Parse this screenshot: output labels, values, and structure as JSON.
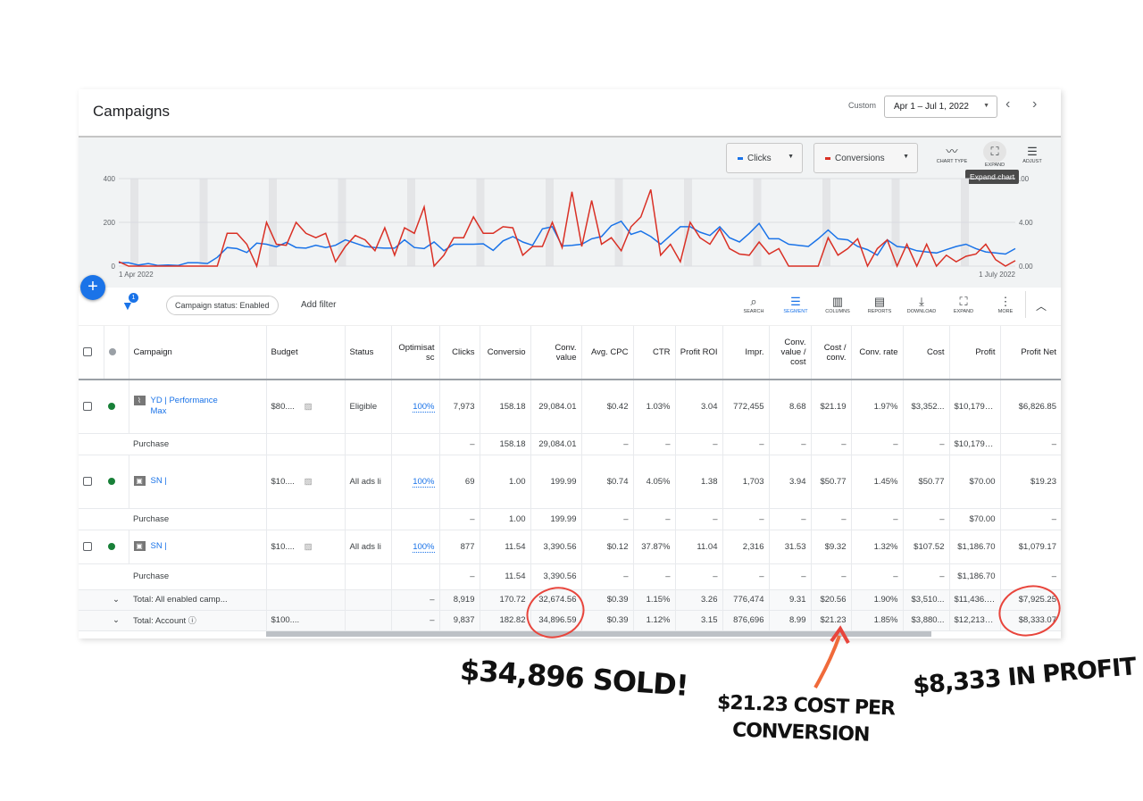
{
  "header": {
    "title": "Campaigns",
    "custom_label": "Custom",
    "date_range": "Apr 1 – Jul 1, 2022",
    "prev_icon": "chevron-left-icon",
    "next_icon": "chevron-right-icon"
  },
  "chart_controls": {
    "metric1": "Clicks",
    "metric2": "Conversions",
    "tools": [
      {
        "label": "CHART TYPE",
        "icon": "line-chart-icon"
      },
      {
        "label": "EXPAND",
        "icon": "expand-icon"
      },
      {
        "label": "ADJUST",
        "icon": "sliders-icon"
      }
    ],
    "tooltip": "Expand chart"
  },
  "chart_data": {
    "type": "line",
    "x_start": "1 Apr 2022",
    "x_end": "1 July 2022",
    "x_labels": [
      "1 Apr 2022",
      "1 July 2022"
    ],
    "y_left": {
      "ticks": [
        "0",
        "200",
        "400"
      ],
      "range": [
        0,
        400
      ]
    },
    "y_right": {
      "ticks": [
        "0.00",
        "4.00",
        ".00"
      ],
      "range": [
        0,
        8
      ]
    },
    "grid": true,
    "legend": "top-right",
    "series": [
      {
        "name": "Clicks",
        "color": "#1a73e8",
        "axis": "left",
        "values": [
          15,
          15,
          5,
          12,
          3,
          5,
          3,
          15,
          15,
          12,
          40,
          85,
          80,
          62,
          105,
          100,
          88,
          108,
          85,
          82,
          95,
          85,
          95,
          120,
          105,
          90,
          85,
          82,
          82,
          120,
          85,
          80,
          110,
          70,
          100,
          100,
          100,
          102,
          72,
          115,
          135,
          110,
          95,
          170,
          180,
          92,
          95,
          100,
          125,
          135,
          185,
          205,
          145,
          160,
          135,
          100,
          140,
          180,
          180,
          155,
          140,
          180,
          130,
          110,
          150,
          195,
          125,
          125,
          100,
          95,
          90,
          125,
          165,
          125,
          120,
          90,
          75,
          50,
          120,
          90,
          85,
          70,
          65,
          60,
          75,
          90,
          100,
          80,
          65,
          60,
          55,
          80
        ]
      },
      {
        "name": "Conversions",
        "color": "#d93025",
        "axis": "right",
        "values": [
          0.4,
          0,
          0,
          0,
          0,
          0,
          0,
          0,
          0,
          0,
          0,
          3,
          3,
          2,
          0,
          4,
          2,
          1.9,
          4,
          3,
          2.6,
          3,
          0.4,
          1.8,
          2.8,
          2.4,
          1.4,
          3.5,
          1,
          3.5,
          3,
          5.4,
          0,
          1,
          2.6,
          2.6,
          4.5,
          3,
          3,
          3.6,
          3.5,
          1,
          1.8,
          1.8,
          4,
          1.7,
          6.8,
          1.8,
          6,
          2,
          2.6,
          1.4,
          3.6,
          4.5,
          7,
          1,
          2,
          0.4,
          4,
          2.6,
          2,
          3.4,
          1.6,
          1.1,
          1,
          2.2,
          1.1,
          1.6,
          0,
          0,
          0,
          0,
          2.6,
          1,
          1.6,
          2.5,
          0,
          1.6,
          2.4,
          0,
          2,
          0,
          2,
          0,
          1,
          0.4,
          0.9,
          1.1,
          2,
          0.6,
          0,
          0.5
        ]
      }
    ]
  },
  "toolbar": {
    "filter_count": "1",
    "chip": "Campaign status: Enabled",
    "add_filter": "Add filter",
    "actions": [
      {
        "label": "SEARCH",
        "icon": "search-icon",
        "active": false
      },
      {
        "label": "SEGMENT",
        "icon": "segment-icon",
        "active": true
      },
      {
        "label": "COLUMNS",
        "icon": "columns-icon",
        "active": false
      },
      {
        "label": "REPORTS",
        "icon": "reports-icon",
        "active": false
      },
      {
        "label": "DOWNLOAD",
        "icon": "download-icon",
        "active": false
      },
      {
        "label": "EXPAND",
        "icon": "expand-icon",
        "active": false
      },
      {
        "label": "MORE",
        "icon": "more-vert-icon",
        "active": false
      }
    ]
  },
  "table": {
    "columns": [
      "Campaign",
      "Budget",
      "Status",
      "Optimisat sc",
      "Clicks",
      "Conversio",
      "Conv. value",
      "Avg. CPC",
      "CTR",
      "Profit ROI",
      "Impr.",
      "Conv. value / cost",
      "Cost / conv.",
      "Conv. rate",
      "Cost",
      "Profit",
      "Profit Net"
    ],
    "rows": [
      {
        "type": "campaign",
        "name": "YD | Performance Max",
        "budget": "$80....",
        "status": "Eligible",
        "opt": "100%",
        "cells": [
          "7,973",
          "158.18",
          "29,084.01",
          "$0.42",
          "1.03%",
          "3.04",
          "772,455",
          "8.68",
          "$21.19",
          "1.97%",
          "$3,352...",
          "$10,179.40",
          "$6,826.85"
        ]
      },
      {
        "type": "sub",
        "name": "Purchase",
        "cells": [
          "–",
          "158.18",
          "29,084.01",
          "–",
          "–",
          "–",
          "–",
          "–",
          "–",
          "–",
          "–",
          "$10,179.40",
          "–"
        ]
      },
      {
        "type": "campaign",
        "name": "SN |",
        "budget": "$10....",
        "status": "All ads li",
        "opt": "100%",
        "cells": [
          "69",
          "1.00",
          "199.99",
          "$0.74",
          "4.05%",
          "1.38",
          "1,703",
          "3.94",
          "$50.77",
          "1.45%",
          "$50.77",
          "$70.00",
          "$19.23"
        ]
      },
      {
        "type": "sub",
        "name": "Purchase",
        "cells": [
          "–",
          "1.00",
          "199.99",
          "–",
          "–",
          "–",
          "–",
          "–",
          "–",
          "–",
          "–",
          "$70.00",
          "–"
        ]
      },
      {
        "type": "campaign",
        "name": "SN |",
        "budget": "$10....",
        "status": "All ads li",
        "opt": "100%",
        "cells": [
          "877",
          "11.54",
          "3,390.56",
          "$0.12",
          "37.87%",
          "11.04",
          "2,316",
          "31.53",
          "$9.32",
          "1.32%",
          "$107.52",
          "$1,186.70",
          "$1,079.17"
        ]
      },
      {
        "type": "sub",
        "name": "Purchase",
        "cells": [
          "–",
          "11.54",
          "3,390.56",
          "–",
          "–",
          "–",
          "–",
          "–",
          "–",
          "–",
          "–",
          "$1,186.70",
          "–"
        ]
      },
      {
        "type": "total",
        "name": "Total: All enabled camp...",
        "budget": "",
        "opt": "–",
        "cells": [
          "8,919",
          "170.72",
          "32,674.56",
          "$0.39",
          "1.15%",
          "3.26",
          "776,474",
          "9.31",
          "$20.56",
          "1.90%",
          "$3,510...",
          "$11,436.10",
          "$7,925.25"
        ]
      },
      {
        "type": "total",
        "name": "Total: Account",
        "budget": "$100....",
        "opt": "–",
        "help": true,
        "cells": [
          "9,837",
          "182.82",
          "34,896.59",
          "$0.39",
          "1.12%",
          "3.15",
          "876,696",
          "8.99",
          "$21.23",
          "1.85%",
          "$3,880...",
          "$12,213.81",
          "$8,333.07"
        ]
      }
    ]
  },
  "annotations": {
    "sold": "$34,896 SOLD!",
    "cpc": "$21.23 COST PER",
    "cpc2": "CONVERSION",
    "profit": "$8,333 IN PROFIT",
    "color": "#e8453c"
  }
}
